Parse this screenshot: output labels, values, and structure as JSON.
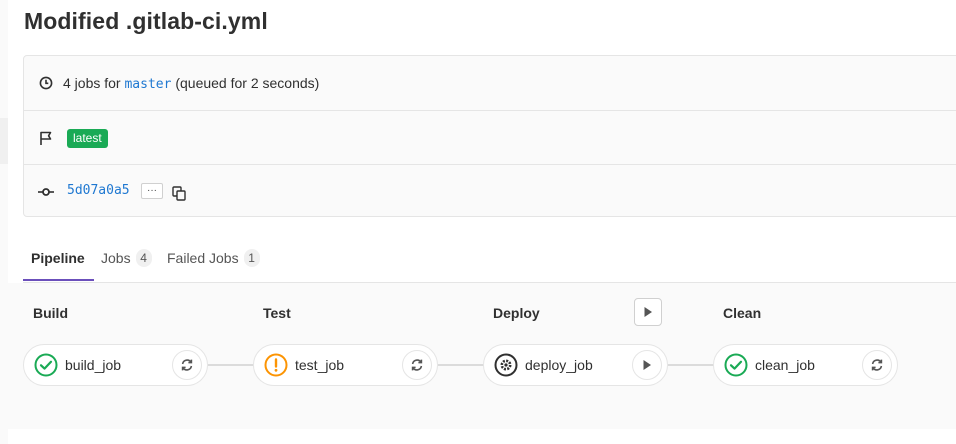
{
  "page": {
    "title": "Modified .gitlab-ci.yml"
  },
  "info": {
    "jobs_prefix": "4 jobs for",
    "branch": "master",
    "queued": "(queued for 2 seconds)",
    "badge": "latest",
    "commit_sha": "5d07a0a5",
    "ellipsis": "···"
  },
  "tabs": [
    {
      "label": "Pipeline",
      "active": true
    },
    {
      "label": "Jobs",
      "count": "4"
    },
    {
      "label": "Failed Jobs",
      "count": "1"
    }
  ],
  "stages": [
    {
      "title": "Build",
      "job": {
        "name": "build_job",
        "status": "success",
        "action": "retry"
      }
    },
    {
      "title": "Test",
      "job": {
        "name": "test_job",
        "status": "warning",
        "action": "retry"
      }
    },
    {
      "title": "Deploy",
      "job": {
        "name": "deploy_job",
        "status": "manual",
        "action": "play"
      }
    },
    {
      "title": "Clean",
      "job": {
        "name": "clean_job",
        "status": "success",
        "action": "retry"
      }
    }
  ],
  "colors": {
    "success": "#1aaa55",
    "warning": "#fc9403",
    "manual": "#303030",
    "link": "#1f78d1",
    "tab_active_underline": "#6b4fbb"
  }
}
